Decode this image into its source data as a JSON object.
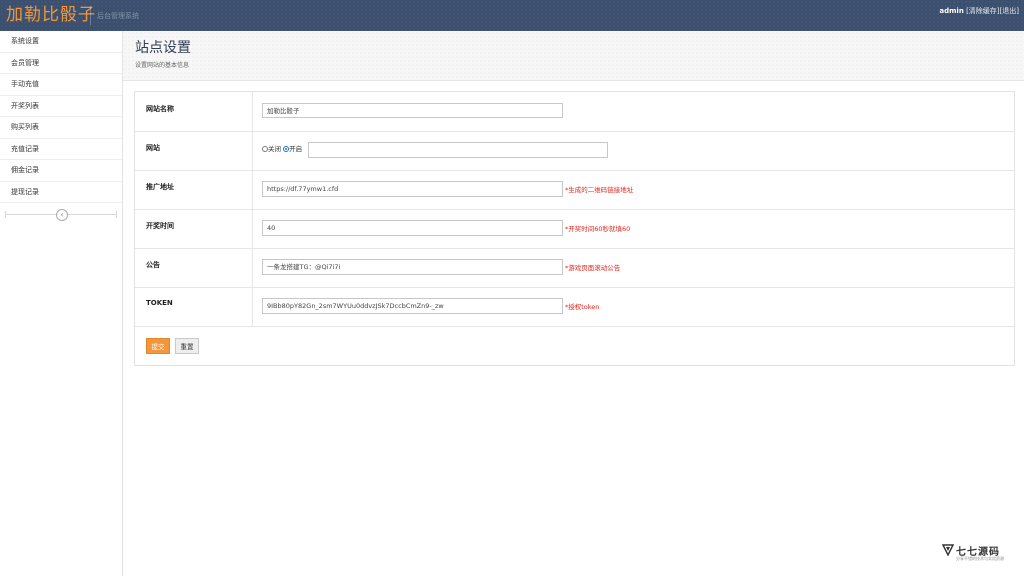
{
  "header": {
    "brand": "加勒比骰子",
    "subtitle": "后台管理系统",
    "user": "admin",
    "links": [
      "[清除缓存]",
      "[退出]"
    ]
  },
  "sidebar": {
    "items": [
      {
        "label": "系统设置"
      },
      {
        "label": "会员管理"
      },
      {
        "label": "手动充值"
      },
      {
        "label": "开奖列表"
      },
      {
        "label": "购买列表"
      },
      {
        "label": "充值记录"
      },
      {
        "label": "佣金记录"
      },
      {
        "label": "提现记录"
      }
    ],
    "collapse_icon": "chevron-left-icon"
  },
  "page": {
    "title": "站点设置",
    "description": "设置网站的基本信息"
  },
  "form": {
    "site_name": {
      "label": "网站名称",
      "value": "加勒比骰子"
    },
    "site": {
      "label": "网站",
      "options": [
        "关闭",
        "开启"
      ],
      "selected": "开启",
      "value": ""
    },
    "promo_url": {
      "label": "推广地址",
      "value": "https://df.77ymw1.cfd",
      "hint": "*生成的二维码链接地址"
    },
    "draw_time": {
      "label": "开奖时间",
      "value": "40",
      "hint": "*开奖时间60秒就填60"
    },
    "notice": {
      "label": "公告",
      "value": "一条龙搭建TG：@Qi7i7i",
      "hint": "*游戏页面滚动公告"
    },
    "token": {
      "label": "TOKEN",
      "value": "9IBb80pY82Gn_2sm7WYUu0ddvzJSk7DccbCmZn9-_zw",
      "hint": "*授权token"
    },
    "submit_label": "提交",
    "reset_label": "重置"
  },
  "watermark": {
    "name": "七七源码",
    "tagline": "分享不错的技术与实用资源",
    "logo_icon": "triangle-logo-icon"
  },
  "colors": {
    "topbar": "#3b4f6e",
    "brand": "#f3963a",
    "hint": "#e0241b",
    "submit": "#f4963b"
  }
}
